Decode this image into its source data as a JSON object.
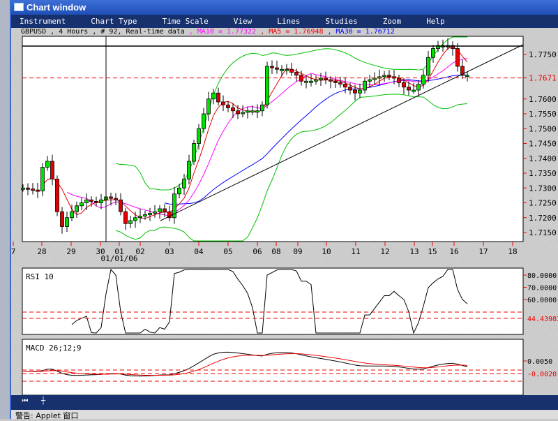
{
  "window": {
    "title": "Chart window"
  },
  "menu": [
    "Instrument",
    "Chart Type",
    "Time Scale",
    "View",
    "Lines",
    "Studies",
    "Zoom",
    "Help"
  ],
  "info": {
    "symbol": "GBPUSD , 4 Hours , # 92, Real-time data",
    "ma10": " , MA10 = 1.77322",
    "ma5": " , MA5 = 1.76948",
    "ma30": " , MA30 = 1.76712",
    "colors": {
      "ma10": "#ff00ff",
      "ma5": "#e00000",
      "ma30": "#0000ff",
      "bands": "#00c000"
    }
  },
  "chart_data": {
    "type": "candlestick",
    "price_axis": [
      "1.7750",
      "1.7671",
      "1.7600",
      "1.7550",
      "1.7500",
      "1.7450",
      "1.7400",
      "1.7350",
      "1.7300",
      "1.7250",
      "1.7200",
      "1.7150"
    ],
    "current_price": "1.7671",
    "date_ticks": [
      "7",
      "28",
      "29",
      "30",
      "01",
      "02",
      "03",
      "04",
      "05",
      "06",
      "08",
      "09",
      "10",
      "11",
      "12",
      "13",
      "15",
      "16",
      "17",
      "18"
    ],
    "date_label": "01/01/06",
    "candles": 92,
    "close_keypoints": [
      [
        0,
        1.73
      ],
      [
        3,
        1.729
      ],
      [
        4,
        1.737
      ],
      [
        5,
        1.739
      ],
      [
        6,
        1.733
      ],
      [
        7,
        1.722
      ],
      [
        8,
        1.717
      ],
      [
        9,
        1.72
      ],
      [
        11,
        1.724
      ],
      [
        13,
        1.726
      ],
      [
        15,
        1.725
      ],
      [
        17,
        1.727
      ],
      [
        19,
        1.726
      ],
      [
        20,
        1.722
      ],
      [
        21,
        1.718
      ],
      [
        23,
        1.72
      ],
      [
        25,
        1.721
      ],
      [
        27,
        1.722
      ],
      [
        28,
        1.723
      ],
      [
        29,
        1.722
      ],
      [
        30,
        1.72
      ],
      [
        31,
        1.728
      ],
      [
        32,
        1.73
      ],
      [
        33,
        1.733
      ],
      [
        34,
        1.739
      ],
      [
        35,
        1.745
      ],
      [
        36,
        1.75
      ],
      [
        37,
        1.755
      ],
      [
        38,
        1.76
      ],
      [
        39,
        1.762
      ],
      [
        40,
        1.759
      ],
      [
        42,
        1.757
      ],
      [
        44,
        1.755
      ],
      [
        46,
        1.756
      ],
      [
        48,
        1.756
      ],
      [
        49,
        1.758
      ],
      [
        50,
        1.771
      ],
      [
        52,
        1.77
      ],
      [
        54,
        1.77
      ],
      [
        56,
        1.768
      ],
      [
        57,
        1.766
      ],
      [
        59,
        1.766
      ],
      [
        61,
        1.767
      ],
      [
        63,
        1.766
      ],
      [
        65,
        1.765
      ],
      [
        66,
        1.764
      ],
      [
        68,
        1.762
      ],
      [
        69,
        1.763
      ],
      [
        70,
        1.766
      ],
      [
        72,
        1.767
      ],
      [
        74,
        1.768
      ],
      [
        76,
        1.767
      ],
      [
        78,
        1.764
      ],
      [
        79,
        1.763
      ],
      [
        80,
        1.763
      ],
      [
        81,
        1.765
      ],
      [
        82,
        1.768
      ],
      [
        83,
        1.774
      ],
      [
        84,
        1.777
      ],
      [
        85,
        1.778
      ],
      [
        86,
        1.778
      ],
      [
        87,
        1.778
      ],
      [
        88,
        1.777
      ],
      [
        89,
        1.771
      ],
      [
        90,
        1.768
      ],
      [
        91,
        1.768
      ]
    ],
    "rsi": {
      "label": "RSI 10",
      "axis": [
        "80.0000",
        "70.0000",
        "60.0000"
      ],
      "current": "44.43983"
    },
    "macd": {
      "label": "MACD 26;12;9",
      "axis": [
        "0.0050"
      ],
      "current": "-0.0020"
    }
  },
  "toolbar": {
    "home": "⏮",
    "crosshair": "┼"
  },
  "status": "警告: Applet 窗口"
}
